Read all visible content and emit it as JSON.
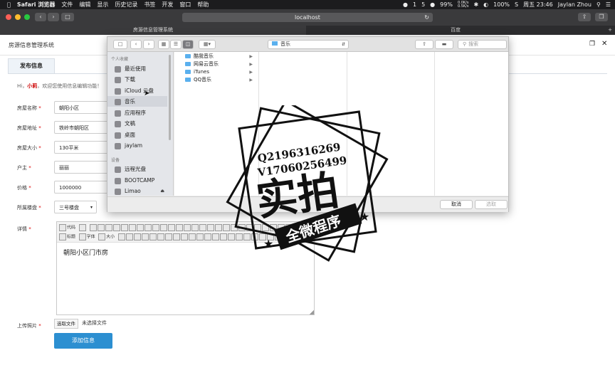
{
  "menubar": {
    "app": "Safari 浏览器",
    "items": [
      "文件",
      "编辑",
      "显示",
      "历史记录",
      "书签",
      "开发",
      "窗口",
      "帮助"
    ],
    "status": {
      "notify1": "1",
      "notify2": "5",
      "battery": "99%",
      "netspeed_up": "0.0K/s",
      "netspeed_down": "0.5K/s",
      "battery_percent": "100%",
      "clock": "周五 23:46",
      "user": "Jaylan Zhou"
    }
  },
  "browser": {
    "url": "localhost",
    "tabs": [
      "房源信息管理系统",
      "百度"
    ]
  },
  "page": {
    "system_title": "房源信息管理系统",
    "tab_label": "发布信息",
    "welcome_prefix": "Hi，",
    "welcome_name": "小莉",
    "welcome_suffix": "，欢迎您使用信息编辑功能！",
    "fields": [
      {
        "label": "房屋名称",
        "value": "朝阳小区"
      },
      {
        "label": "房屋地址",
        "value": "铁岭市朝阳区"
      },
      {
        "label": "房屋大小",
        "value": "130平米"
      },
      {
        "label": "户主",
        "value": "丽丽"
      },
      {
        "label": "价格",
        "value": "1000000"
      },
      {
        "label": "所属楼盘",
        "value": "三号楼盘"
      }
    ],
    "required_mark": "*",
    "detail_label": "详情",
    "editor_row1": [
      "代码"
    ],
    "editor_row2": [
      "标题",
      "字体",
      "大小"
    ],
    "editor_content": "朝阳小区门市房",
    "upload_label": "上传照片",
    "file_button": "选取文件",
    "file_status": "未选择文件",
    "submit_label": "添加信息"
  },
  "dialog": {
    "path": "音乐",
    "search_placeholder": "搜索",
    "section_personal": "个人收藏",
    "favorites": [
      "最近使用",
      "下载",
      "iCloud 云盘",
      "音乐",
      "应用程序",
      "文稿",
      "桌面",
      "jaylam"
    ],
    "selected_favorite": "音乐",
    "section_devices": "设备",
    "devices": [
      "远程光盘",
      "BOOTCAMP",
      "Limao"
    ],
    "files": [
      "酷我音乐",
      "网易云音乐",
      "iTunes",
      "QQ音乐"
    ],
    "cancel_label": "取消",
    "choose_label": "选取"
  },
  "watermark": {
    "line1": "Q2196316269",
    "line2": "V17060256499",
    "main": "实拍",
    "banner": "全微程序"
  }
}
